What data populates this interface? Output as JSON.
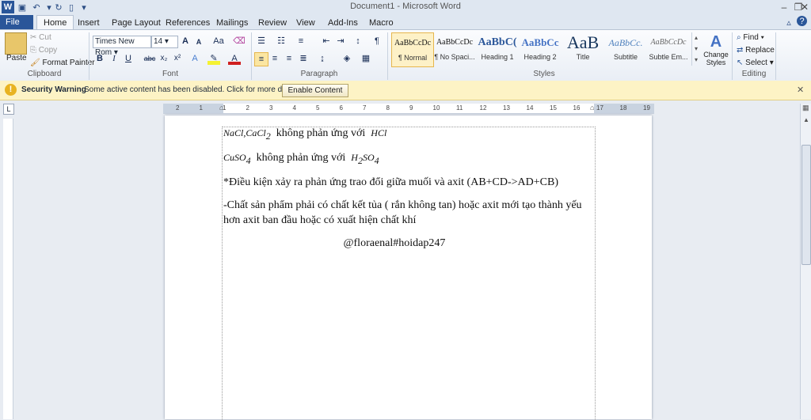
{
  "window": {
    "title": "Document1 - Microsoft Word"
  },
  "tabs": [
    "File",
    "Home",
    "Insert",
    "Page Layout",
    "References",
    "Mailings",
    "Review",
    "View",
    "Add-Ins",
    "Macro"
  ],
  "clipboard": {
    "paste": "Paste",
    "cut": "Cut",
    "copy": "Copy",
    "format_painter": "Format Painter",
    "label": "Clipboard"
  },
  "font": {
    "name": "Times New Rom",
    "size": "14",
    "grow": "A",
    "shrink": "A",
    "case": "Aa",
    "bold": "B",
    "italic": "I",
    "underline": "U",
    "strike": "abc",
    "subscript": "x₂",
    "superscript": "x²",
    "label": "Font"
  },
  "paragraph": {
    "label": "Paragraph",
    "show_marks": "¶"
  },
  "styles": {
    "label": "Styles",
    "items": [
      {
        "sample": "AaBbCcDc",
        "name": "¶ Normal"
      },
      {
        "sample": "AaBbCcDc",
        "name": "¶ No Spaci..."
      },
      {
        "sample": "AaBbC(",
        "name": "Heading 1"
      },
      {
        "sample": "AaBbCc",
        "name": "Heading 2"
      },
      {
        "sample": "AaB",
        "name": "Title"
      },
      {
        "sample": "AaBbCc.",
        "name": "Subtitle"
      },
      {
        "sample": "AaBbCcDc",
        "name": "Subtle Em..."
      }
    ],
    "change_styles": "Change Styles"
  },
  "editing": {
    "label": "Editing",
    "find": "Find",
    "replace": "Replace",
    "select": "Select"
  },
  "security": {
    "title": "Security Warning",
    "message": "Some active content has been disabled. Click for more details.",
    "button": "Enable Content"
  },
  "ruler": {
    "numbers": [
      "2",
      "1",
      "1",
      "2",
      "3",
      "4",
      "5",
      "6",
      "7",
      "8",
      "9",
      "10",
      "11",
      "12",
      "13",
      "14",
      "15",
      "16",
      "17",
      "18",
      "19"
    ]
  },
  "document": {
    "line1_formula": "NaCl,CaCl",
    "line1_sub": "2",
    "line1_text": "không phản ứng với",
    "line1_acid": "HCl",
    "line2_formula": "CuSO",
    "line2_sub": "4",
    "line2_text": "không phản ứng với",
    "line2_acid_a": "H",
    "line2_acid_sub_a": "2",
    "line2_acid_b": "SO",
    "line2_acid_sub_b": "4",
    "line3": "*Điều kiện xảy ra phản ứng trao đổi giữa muối và axit (AB+CD->AD+CB)",
    "line4": "-Chất sản phẩm phải có chất kết tủa ( rắn không tan) hoặc axit mới tạo thành yếu",
    "line5": "hơn axit ban đầu hoặc có xuất hiện chất khí",
    "line6": "@floraenal#hoidap247"
  }
}
